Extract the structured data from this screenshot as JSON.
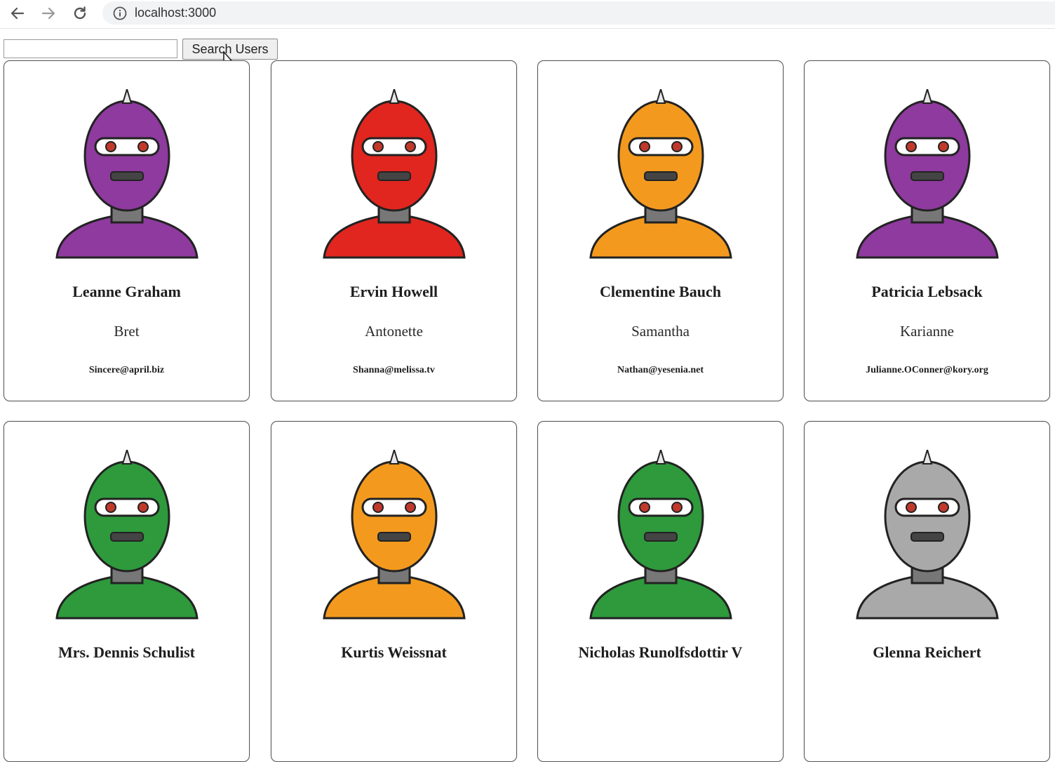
{
  "browser": {
    "url": "localhost:3000",
    "icons": [
      "back-arrow-icon",
      "forward-arrow-icon",
      "reload-icon",
      "info-icon"
    ]
  },
  "search": {
    "input_value": "",
    "button_label": "Search Users"
  },
  "users": [
    {
      "name": "Leanne Graham",
      "username": "Bret",
      "email": "Sincere@april.biz",
      "robot_color": "#8e3a9e"
    },
    {
      "name": "Ervin Howell",
      "username": "Antonette",
      "email": "Shanna@melissa.tv",
      "robot_color": "#e0261f"
    },
    {
      "name": "Clementine Bauch",
      "username": "Samantha",
      "email": "Nathan@yesenia.net",
      "robot_color": "#f39a1e"
    },
    {
      "name": "Patricia Lebsack",
      "username": "Karianne",
      "email": "Julianne.OConner@kory.org",
      "robot_color": "#8e3a9e"
    },
    {
      "name": "Mrs. Dennis Schulist",
      "username": "",
      "email": "",
      "robot_color": "#2e9a3c"
    },
    {
      "name": "Kurtis Weissnat",
      "username": "",
      "email": "",
      "robot_color": "#f39a1e"
    },
    {
      "name": "Nicholas Runolfsdottir V",
      "username": "",
      "email": "",
      "robot_color": "#2e9a3c"
    },
    {
      "name": "Glenna Reichert",
      "username": "",
      "email": "",
      "robot_color": "#a9a9a9"
    }
  ]
}
